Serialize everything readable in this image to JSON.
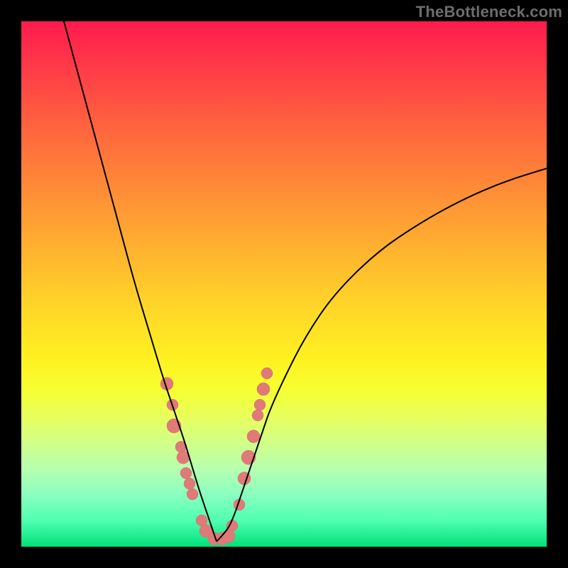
{
  "watermark": "TheBottleneck.com",
  "colors": {
    "dot_fill": "#e07a78",
    "dot_stroke": "#d06a68",
    "curve": "#000000",
    "frame_bg_top": "#ff1a4d",
    "frame_bg_bottom": "#00e07a",
    "page_bg": "#000000"
  },
  "chart_data": {
    "type": "line",
    "title": "",
    "xlabel": "",
    "ylabel": "",
    "x_range": [
      0,
      740
    ],
    "y_range_percent": [
      0,
      100
    ],
    "note": "V-shaped bottleneck curve; minimum (~0%) near x≈275. Left branch rises steeply to ~100% at x≈60; right branch rises to ~72% at x=740. Y expressed as percent of plot height from bottom.",
    "series": [
      {
        "name": "curve-left",
        "x": [
          60,
          80,
          100,
          120,
          140,
          160,
          180,
          200,
          210,
          220,
          230,
          240,
          250,
          260,
          270,
          275
        ],
        "y_percent": [
          100,
          90,
          80,
          70,
          60,
          50,
          41,
          32,
          28,
          24,
          20,
          15.5,
          11,
          7,
          3,
          1
        ]
      },
      {
        "name": "curve-right",
        "x": [
          275,
          290,
          300,
          310,
          320,
          330,
          340,
          350,
          370,
          400,
          440,
          500,
          560,
          620,
          680,
          740
        ],
        "y_percent": [
          1,
          3,
          6,
          10,
          14,
          18,
          22,
          26,
          32,
          40,
          48,
          56,
          61.5,
          66,
          69.5,
          72
        ]
      }
    ],
    "scatter": {
      "name": "sample-points",
      "points": [
        {
          "x": 205,
          "y_percent": 31,
          "r": 9
        },
        {
          "x": 213,
          "y_percent": 27,
          "r": 8
        },
        {
          "x": 215,
          "y_percent": 23,
          "r": 10
        },
        {
          "x": 225,
          "y_percent": 19,
          "r": 8
        },
        {
          "x": 228,
          "y_percent": 17,
          "r": 9
        },
        {
          "x": 232,
          "y_percent": 14,
          "r": 8
        },
        {
          "x": 237,
          "y_percent": 12,
          "r": 8
        },
        {
          "x": 241,
          "y_percent": 10,
          "r": 8
        },
        {
          "x": 254,
          "y_percent": 5,
          "r": 8
        },
        {
          "x": 260,
          "y_percent": 3,
          "r": 9
        },
        {
          "x": 272,
          "y_percent": 1.5,
          "r": 9
        },
        {
          "x": 283,
          "y_percent": 1.5,
          "r": 9
        },
        {
          "x": 292,
          "y_percent": 2,
          "r": 9
        },
        {
          "x": 297,
          "y_percent": 4,
          "r": 8
        },
        {
          "x": 307,
          "y_percent": 8,
          "r": 8
        },
        {
          "x": 314,
          "y_percent": 13,
          "r": 9
        },
        {
          "x": 320,
          "y_percent": 17,
          "r": 10
        },
        {
          "x": 327,
          "y_percent": 21,
          "r": 9
        },
        {
          "x": 333,
          "y_percent": 25,
          "r": 8
        },
        {
          "x": 336,
          "y_percent": 27,
          "r": 8
        },
        {
          "x": 341,
          "y_percent": 30,
          "r": 9
        },
        {
          "x": 346,
          "y_percent": 33,
          "r": 8
        }
      ]
    }
  }
}
